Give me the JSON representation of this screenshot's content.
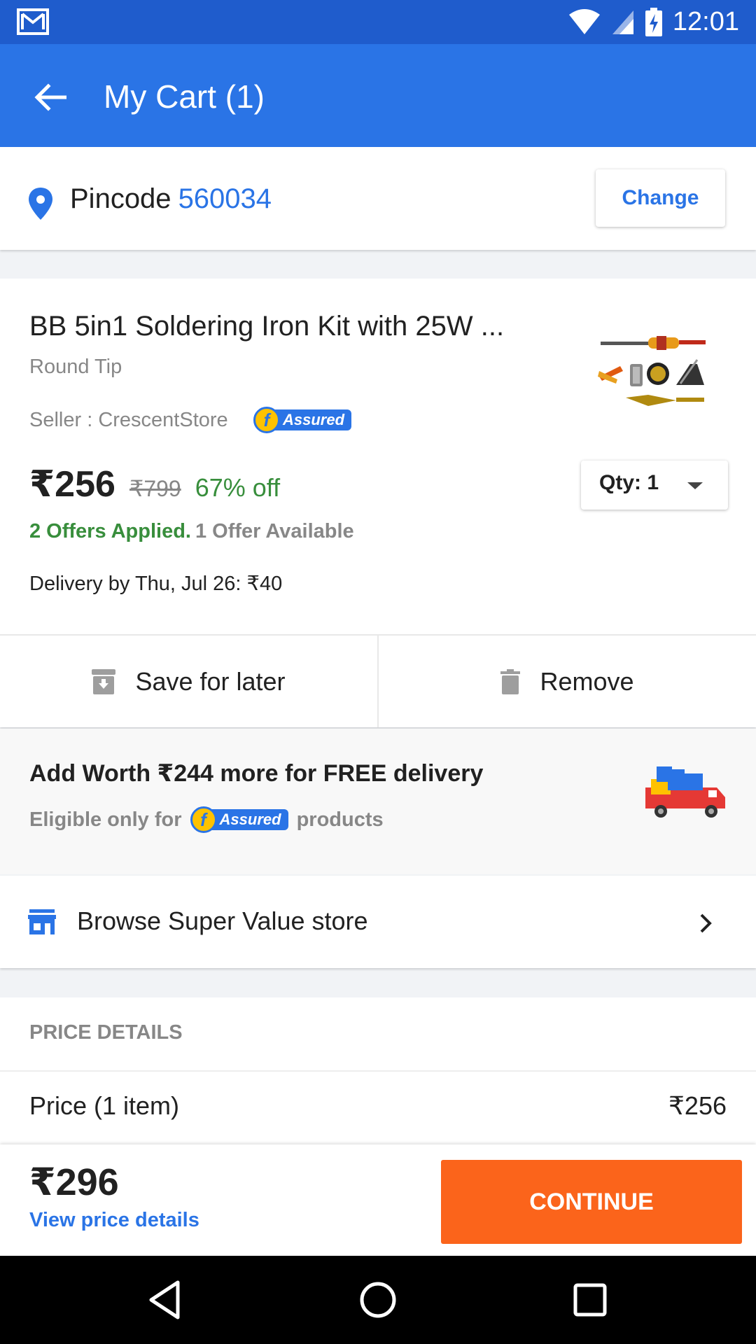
{
  "status_bar": {
    "time": "12:01",
    "icons": [
      "gmail-icon",
      "wifi-icon",
      "signal-icon",
      "battery-charging-icon"
    ]
  },
  "toolbar": {
    "back_icon": "arrow-back-icon",
    "title": "My Cart (1)"
  },
  "pincode": {
    "label": "Pincode",
    "value": "560034",
    "change_label": "Change",
    "icon": "location-pin-icon"
  },
  "product": {
    "title": "BB 5in1 Soldering Iron Kit with 25W ...",
    "variant": "Round Tip",
    "seller": "Seller : CrescentStore",
    "assured_badge": "Assured",
    "price": "₹256",
    "mrp": "₹799",
    "discount": "67% off",
    "offers_applied": "2 Offers Applied.",
    "offers_available": "1 Offer Available",
    "delivery": "Delivery by Thu, Jul 26: ₹40",
    "qty_label": "Qty:  1"
  },
  "actions": {
    "save_label": "Save for later",
    "remove_label": "Remove"
  },
  "free_delivery": {
    "title": "Add Worth ₹244 more for FREE delivery",
    "sub_prefix": "Eligible only for",
    "sub_suffix": "products",
    "badge": "Assured"
  },
  "browse": {
    "label": "Browse Super Value store"
  },
  "price_details": {
    "heading": "PRICE DETAILS",
    "rows": [
      {
        "label": "Price (1 item)",
        "value": "₹256"
      }
    ]
  },
  "bottom_bar": {
    "total": "₹296",
    "view_details": "View price details",
    "continue_label": "CONTINUE"
  },
  "colors": {
    "status_bar": "#1f5ccc",
    "toolbar": "#2a74e6",
    "accent_blue": "#2a74e6",
    "green": "#388e3c",
    "continue_orange": "#fb641b",
    "assured_yellow": "#ffc200"
  }
}
